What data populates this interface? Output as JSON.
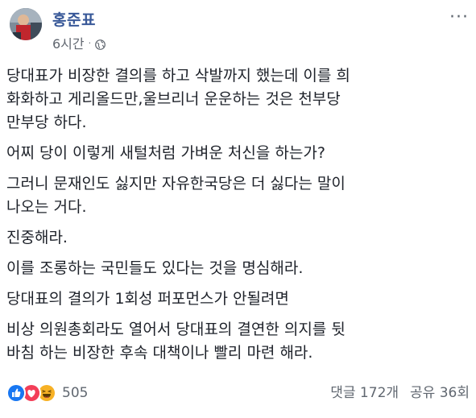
{
  "post": {
    "author": "홍준표",
    "time": "6시간",
    "separator": "·",
    "more": "···",
    "paragraphs": [
      "당대표가 비장한 결의를 하고 삭발까지 했는데 이를 희\n화화하고 게리올드만,울브리너 운운하는 것은 천부당\n만부당 하다.",
      "어찌 당이 이렇게 새털처럼 가벼운 처신을 하는가?",
      "그러니 문재인도 싫지만 자유한국당은 더 싫다는 말이\n나오는 거다.",
      "진중해라.",
      "이를 조롱하는 국민들도 있다는 것을 명심해라.",
      "당대표의 결의가 1회성 퍼포먼스가 안될려면",
      "비상 의원총회라도 열어서 당대표의 결연한 의지를 뒷\n바침 하는 비장한 후속 대책이나 빨리 마련 해라."
    ]
  },
  "footer": {
    "reaction_count": "505",
    "comments": "댓글 172개",
    "shares": "공유 36회"
  },
  "colors": {
    "author": "#385898",
    "meta": "#616770",
    "text": "#1d2129",
    "like": "#1877f2",
    "love": "#f33e58",
    "haha": "#f7b125"
  },
  "icons": {
    "globe": "globe-icon",
    "like": "like-reaction-icon",
    "love": "love-reaction-icon",
    "haha": "haha-reaction-icon"
  }
}
